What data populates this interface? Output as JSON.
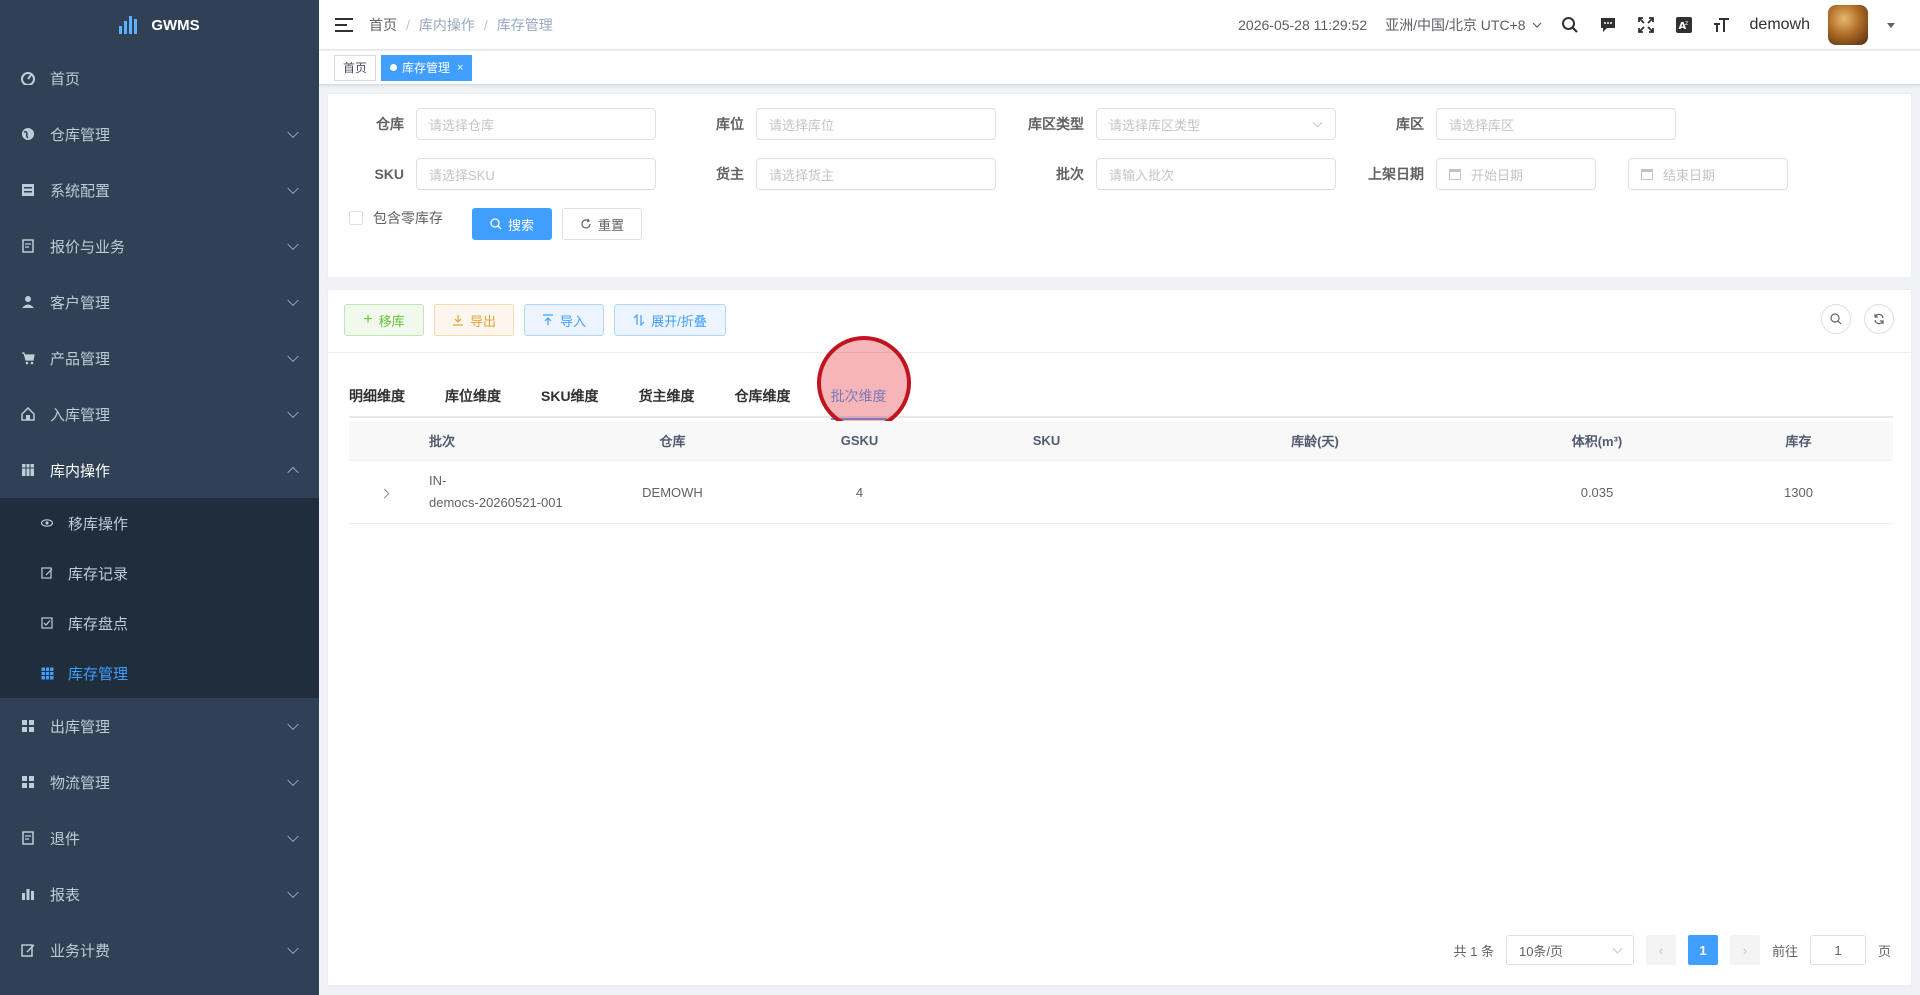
{
  "app": {
    "name": "GWMS"
  },
  "sidebar": {
    "items": [
      {
        "label": "首页",
        "icon": "dashboard-icon",
        "has_children": false
      },
      {
        "label": "仓库管理",
        "icon": "globe-icon",
        "has_children": true
      },
      {
        "label": "系统配置",
        "icon": "server-icon",
        "has_children": true
      },
      {
        "label": "报价与业务",
        "icon": "document-icon",
        "has_children": true
      },
      {
        "label": "客户管理",
        "icon": "user-icon",
        "has_children": true
      },
      {
        "label": "产品管理",
        "icon": "cart-icon",
        "has_children": true
      },
      {
        "label": "入库管理",
        "icon": "home-icon",
        "has_children": true
      },
      {
        "label": "库内操作",
        "icon": "table-icon",
        "has_children": true,
        "expanded": true
      },
      {
        "label": "出库管理",
        "icon": "grid-icon",
        "has_children": true
      },
      {
        "label": "物流管理",
        "icon": "grid-icon",
        "has_children": true
      },
      {
        "label": "退件",
        "icon": "document-icon",
        "has_children": true
      },
      {
        "label": "报表",
        "icon": "chart-icon",
        "has_children": true
      },
      {
        "label": "业务计费",
        "icon": "edit-icon",
        "has_children": true
      }
    ],
    "submenu": [
      {
        "label": "移库操作",
        "icon": "eye-icon"
      },
      {
        "label": "库存记录",
        "icon": "edit-icon"
      },
      {
        "label": "库存盘点",
        "icon": "checkbox-icon"
      },
      {
        "label": "库存管理",
        "icon": "table-icon",
        "active": true
      }
    ]
  },
  "navbar": {
    "breadcrumb": [
      "首页",
      "库内操作",
      "库存管理"
    ],
    "datetime": "2026-05-28 11:29:52",
    "timezone": "亚洲/中国/北京 UTC+8",
    "username": "demowh"
  },
  "tags": {
    "home": "首页",
    "current": "库存管理",
    "close": "×"
  },
  "filters": {
    "warehouse": {
      "label": "仓库",
      "placeholder": "请选择仓库"
    },
    "location": {
      "label": "库位",
      "placeholder": "请选择库位"
    },
    "zone_type": {
      "label": "库区类型",
      "placeholder": "请选择库区类型"
    },
    "zone": {
      "label": "库区",
      "placeholder": "请选择库区"
    },
    "sku": {
      "label": "SKU",
      "placeholder": "请选择SKU"
    },
    "owner": {
      "label": "货主",
      "placeholder": "请选择货主"
    },
    "batch": {
      "label": "批次",
      "placeholder": "请输入批次"
    },
    "shelf_date": {
      "label": "上架日期",
      "start": "开始日期",
      "end": "结束日期"
    },
    "zero_stock": "包含零库存",
    "search": "搜索",
    "reset": "重置"
  },
  "toolbar": {
    "move": "移库",
    "export": "导出",
    "import": "导入",
    "expand": "展开/折叠"
  },
  "tabs": [
    "明细维度",
    "库位维度",
    "SKU维度",
    "货主维度",
    "仓库维度",
    "批次维度"
  ],
  "active_tab": "批次维度",
  "table": {
    "columns": [
      "",
      "批次",
      "仓库",
      "GSKU",
      "SKU",
      "库龄(天)",
      "体积(m³)",
      "库存"
    ],
    "rows": [
      {
        "batch": "IN-\ndemocs-20260521-001",
        "warehouse": "DEMOWH",
        "gsku": "4",
        "sku": "",
        "age": "",
        "volume": "0.035",
        "stock": "1300"
      }
    ]
  },
  "pagination": {
    "total": "共 1 条",
    "page_size": "10条/页",
    "current": "1",
    "goto": "前往",
    "goto_value": "1",
    "page_unit": "页"
  },
  "colors": {
    "primary": "#409eff",
    "sidebar": "#304156",
    "submenu": "#1f2d3d",
    "marker": "#c0141e"
  }
}
